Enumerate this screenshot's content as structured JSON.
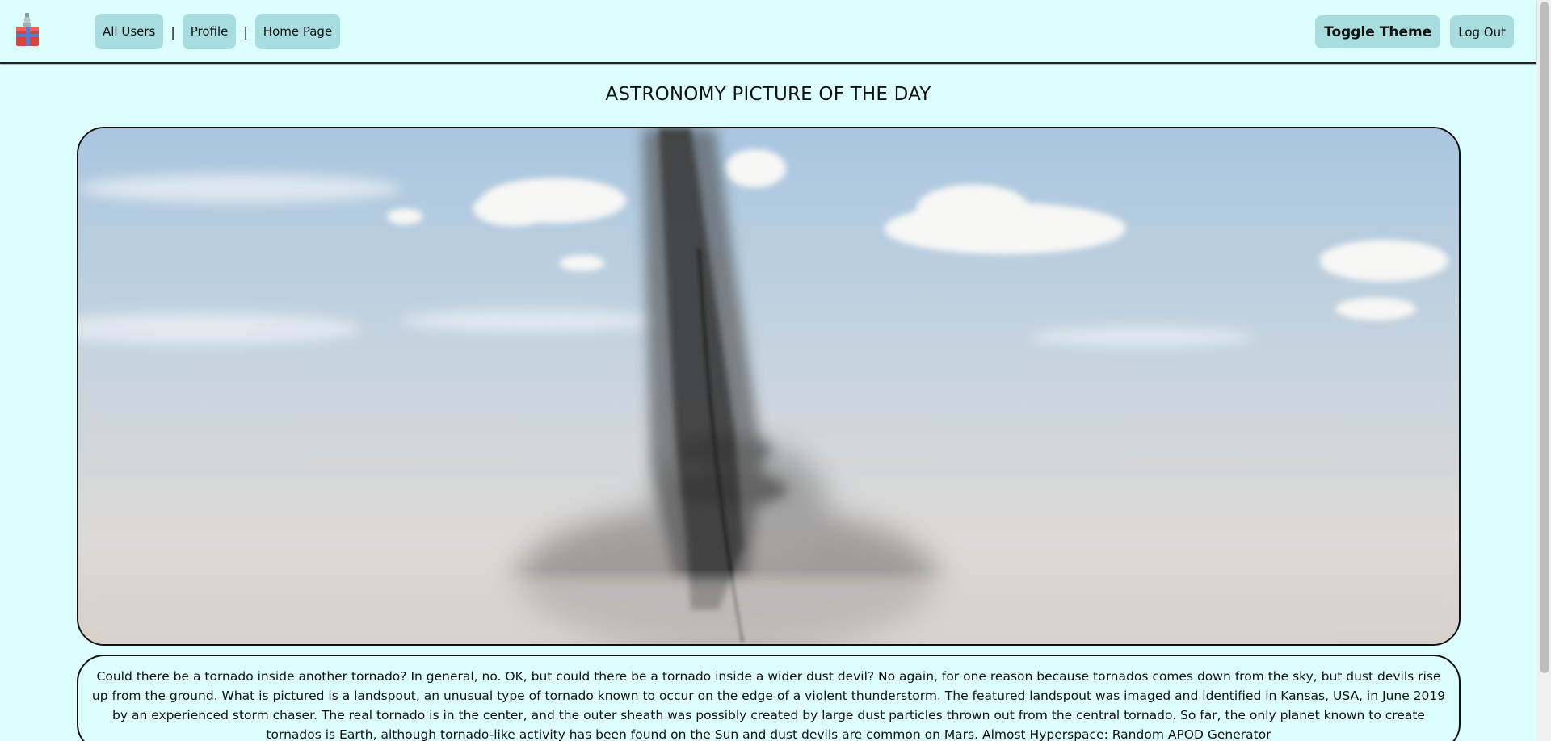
{
  "colors": {
    "background": "#dcfffe",
    "button": "#a8dde0",
    "border": "#111111"
  },
  "header": {
    "logo_icon": "gift-box-robot-logo",
    "nav": {
      "all_users": "All Users",
      "separator": "|",
      "profile": "Profile",
      "home_page": "Home Page"
    },
    "toggle_theme": "Toggle Theme",
    "log_out": "Log Out"
  },
  "main": {
    "title": "ASTRONOMY PICTURE OF THE DAY",
    "image_alt": "Landspout tornado inside a wider dust column",
    "explanation": "Could there be a tornado inside another tornado? In general, no. OK, but could there be a tornado inside a wider dust devil? No again, for one reason because tornados comes down from the sky, but dust devils rise up from the ground. What is pictured is a landspout, an unusual type of tornado known to occur on the edge of a violent thunderstorm. The featured landspout was imaged and identified in Kansas, USA, in June 2019 by an experienced storm chaser. The real tornado is in the center, and the outer sheath was possibly created by large dust particles thrown out from the central tornado. So far, the only planet known to create tornados is Earth, although tornado-like activity has been found on the Sun and dust devils are common on Mars. Almost Hyperspace: Random APOD Generator"
  }
}
